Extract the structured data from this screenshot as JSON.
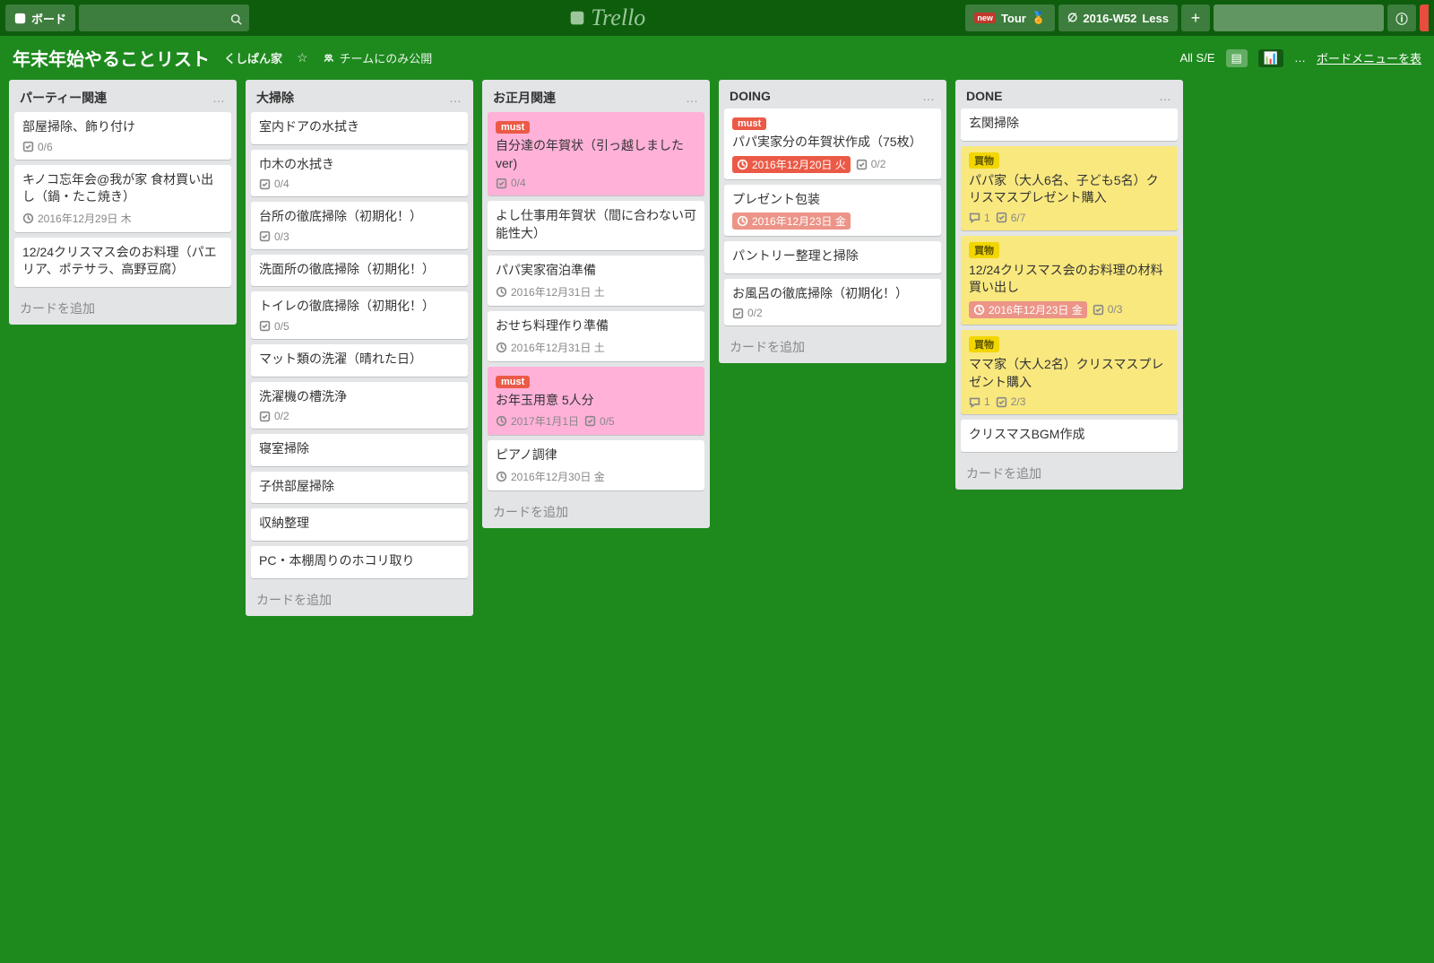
{
  "topbar": {
    "boards_label": "ボード",
    "logo": "Trello",
    "tour_label": "Tour",
    "week_label": "2016-W52",
    "less_label": "Less",
    "plus": "+"
  },
  "boardbar": {
    "title": "年末年始やることリスト",
    "team": "くしぱん家",
    "visibility": "チームにのみ公開",
    "all_se": "All S/E",
    "menu": "ボードメニューを表",
    "ellipsis": "…"
  },
  "lists": [
    {
      "title": "パーティー関連",
      "cards": [
        {
          "title": "部屋掃除、飾り付け",
          "badges": [
            {
              "type": "check",
              "text": "0/6"
            }
          ]
        },
        {
          "title": "キノコ忘年会@我が家 食材買い出し（鍋・たこ焼き）",
          "badges": [
            {
              "type": "due",
              "text": "2016年12月29日 木"
            }
          ]
        },
        {
          "title": "12/24クリスマス会のお料理（パエリア、ポテサラ、高野豆腐）"
        }
      ],
      "add": "カードを追加"
    },
    {
      "title": "大掃除",
      "cards": [
        {
          "title": "室内ドアの水拭き"
        },
        {
          "title": "巾木の水拭き",
          "badges": [
            {
              "type": "check",
              "text": "0/4"
            }
          ]
        },
        {
          "title": "台所の徹底掃除（初期化！）",
          "badges": [
            {
              "type": "check",
              "text": "0/3"
            }
          ]
        },
        {
          "title": "洗面所の徹底掃除（初期化！）"
        },
        {
          "title": "トイレの徹底掃除（初期化！）",
          "badges": [
            {
              "type": "check",
              "text": "0/5"
            }
          ]
        },
        {
          "title": "マット類の洗濯（晴れた日）"
        },
        {
          "title": "洗濯機の槽洗浄",
          "badges": [
            {
              "type": "check",
              "text": "0/2"
            }
          ]
        },
        {
          "title": "寝室掃除"
        },
        {
          "title": "子供部屋掃除"
        },
        {
          "title": "収納整理"
        },
        {
          "title": "PC・本棚周りのホコリ取り"
        }
      ],
      "add": "カードを追加"
    },
    {
      "title": "お正月関連",
      "cards": [
        {
          "bg": "pink",
          "labels": [
            {
              "color": "red",
              "text": "must"
            }
          ],
          "title": "自分達の年賀状（引っ越しましたver)",
          "badges": [
            {
              "type": "check",
              "text": "0/4"
            }
          ]
        },
        {
          "title": "よし仕事用年賀状（間に合わない可能性大）"
        },
        {
          "title": "パパ実家宿泊準備",
          "badges": [
            {
              "type": "due",
              "text": "2016年12月31日 土"
            }
          ]
        },
        {
          "title": "おせち料理作り準備",
          "badges": [
            {
              "type": "due",
              "text": "2016年12月31日 土"
            }
          ]
        },
        {
          "bg": "pink",
          "labels": [
            {
              "color": "red",
              "text": "must"
            }
          ],
          "title": "お年玉用意 5人分",
          "badges": [
            {
              "type": "due",
              "text": "2017年1月1日"
            },
            {
              "type": "check",
              "text": "0/5"
            }
          ]
        },
        {
          "title": "ピアノ調律",
          "badges": [
            {
              "type": "due",
              "text": "2016年12月30日 金"
            }
          ]
        }
      ],
      "add": "カードを追加"
    },
    {
      "title": "DOING",
      "cards": [
        {
          "labels": [
            {
              "color": "red",
              "text": "must"
            }
          ],
          "title": "パパ実家分の年賀状作成（75枚）",
          "badges": [
            {
              "type": "due-past-bright",
              "text": "2016年12月20日 火"
            },
            {
              "type": "check",
              "text": "0/2"
            }
          ]
        },
        {
          "title": "プレゼント包装",
          "badges": [
            {
              "type": "due-past",
              "text": "2016年12月23日 金"
            }
          ]
        },
        {
          "title": "パントリー整理と掃除"
        },
        {
          "title": "お風呂の徹底掃除（初期化！）",
          "badges": [
            {
              "type": "check",
              "text": "0/2"
            }
          ]
        }
      ],
      "add": "カードを追加"
    },
    {
      "title": "DONE",
      "cards": [
        {
          "title": "玄関掃除"
        },
        {
          "bg": "yellow",
          "labels": [
            {
              "color": "yellow",
              "text": "買物"
            }
          ],
          "title": "パパ家（大人6名、子ども5名）クリスマスプレゼント購入",
          "badges": [
            {
              "type": "comment",
              "text": "1"
            },
            {
              "type": "check",
              "text": "6/7"
            }
          ]
        },
        {
          "bg": "yellow",
          "labels": [
            {
              "color": "yellow",
              "text": "買物"
            }
          ],
          "title": "12/24クリスマス会のお料理の材料買い出し",
          "badges": [
            {
              "type": "due-past",
              "text": "2016年12月23日 金"
            },
            {
              "type": "check",
              "text": "0/3"
            }
          ]
        },
        {
          "bg": "yellow",
          "labels": [
            {
              "color": "yellow",
              "text": "買物"
            }
          ],
          "title": "ママ家（大人2名）クリスマスプレゼント購入",
          "badges": [
            {
              "type": "comment",
              "text": "1"
            },
            {
              "type": "check",
              "text": "2/3"
            }
          ]
        },
        {
          "title": "クリスマスBGM作成"
        }
      ],
      "add": "カードを追加"
    }
  ]
}
